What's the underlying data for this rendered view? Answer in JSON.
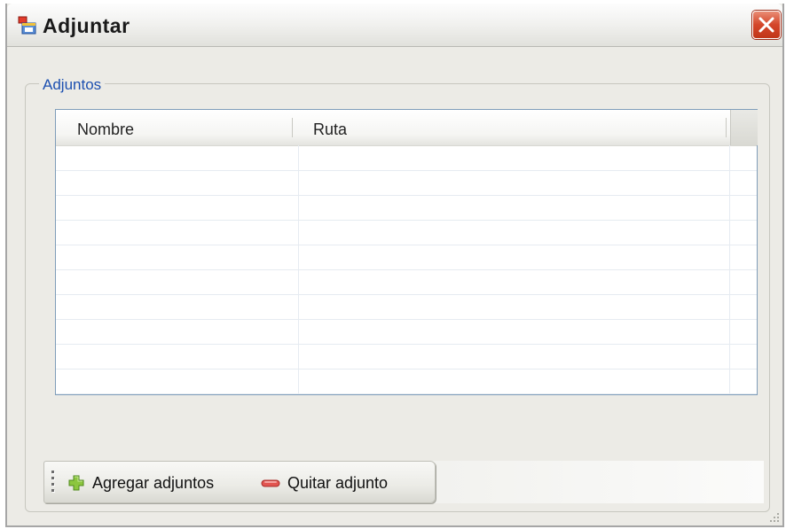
{
  "window": {
    "title": "Adjuntar",
    "icon": "app-window-icon",
    "close_icon": "close-icon"
  },
  "group": {
    "label": "Adjuntos"
  },
  "grid": {
    "columns": [
      "Nombre",
      "Ruta"
    ],
    "rows": []
  },
  "toolbar": {
    "add_label": "Agregar adjuntos",
    "add_icon": "plus-icon",
    "remove_label": "Quitar adjunto",
    "remove_icon": "minus-icon"
  },
  "colors": {
    "accent_blue": "#1c4fb0",
    "close_red": "#d4462a",
    "plus_green": "#8cc63f",
    "minus_red": "#e25550"
  }
}
